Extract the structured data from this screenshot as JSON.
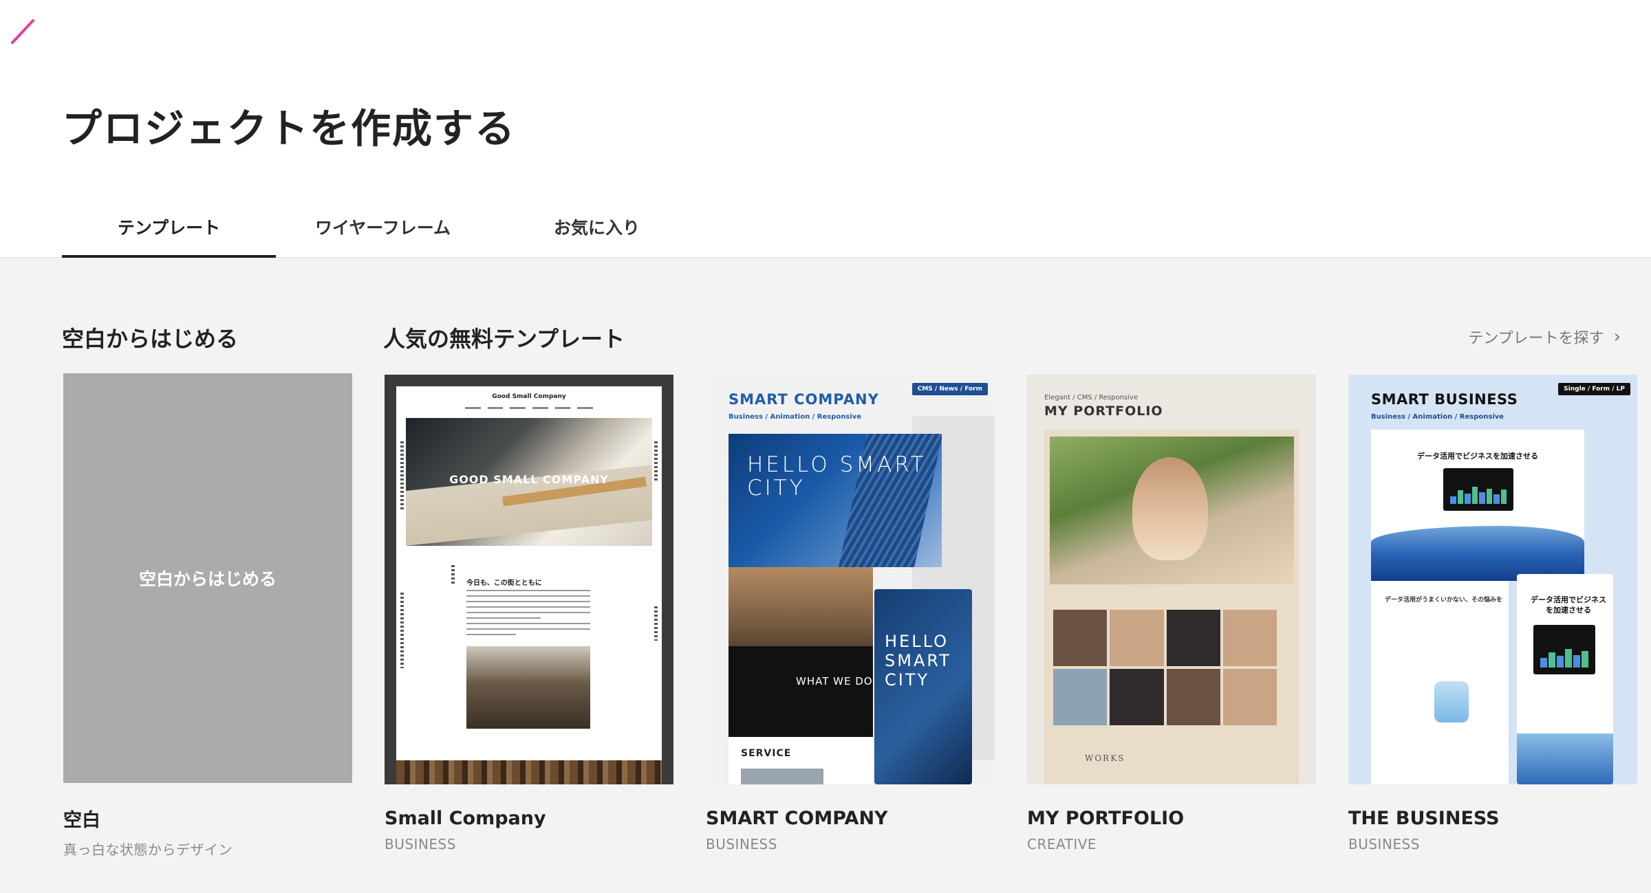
{
  "header": {
    "title": "プロジェクトを作成する",
    "accent_color": "#e0409a"
  },
  "tabs": [
    {
      "label": "テンプレート",
      "active": true
    },
    {
      "label": "ワイヤーフレーム",
      "active": false
    },
    {
      "label": "お気に入り",
      "active": false
    }
  ],
  "blank_section": {
    "title": "空白からはじめる",
    "card_label": "空白からはじめる",
    "name": "空白",
    "description": "真っ白な状態からデザイン"
  },
  "templates_section": {
    "title": "人気の無料テンプレート",
    "browse_label": "テンプレートを探す"
  },
  "templates": [
    {
      "name": "Small Company",
      "category": "BUSINESS",
      "preview": {
        "logo": "Good Small Company",
        "hero_text": "GOOD SMALL COMPANY",
        "heading": "今日も、この街とともに"
      }
    },
    {
      "name": "SMART COMPANY",
      "category": "BUSINESS",
      "preview": {
        "brand": "SMART COMPANY",
        "tags": "Business / Animation / Responsive",
        "badge": "CMS / News / Form",
        "hero_text": "HELLO SMART CITY",
        "section_text": "WHAT WE DO",
        "service_text": "SERVICE"
      }
    },
    {
      "name": "MY PORTFOLIO",
      "category": "CREATIVE",
      "preview": {
        "tags": "Elegant / CMS / Responsive",
        "title": "MY PORTFOLIO",
        "footer_text": "WORKS"
      }
    },
    {
      "name": "THE BUSINESS",
      "category": "BUSINESS",
      "preview": {
        "brand": "SMART BUSINESS",
        "tags": "Business / Animation / Responsive",
        "badge": "Single / Form / LP",
        "hero_heading": "データ活用でビジネスを加速させる",
        "section_heading": "データ活用がうまくいかない、その悩みを",
        "phone_heading": "データ活用でビジネスを加速させる"
      }
    }
  ]
}
